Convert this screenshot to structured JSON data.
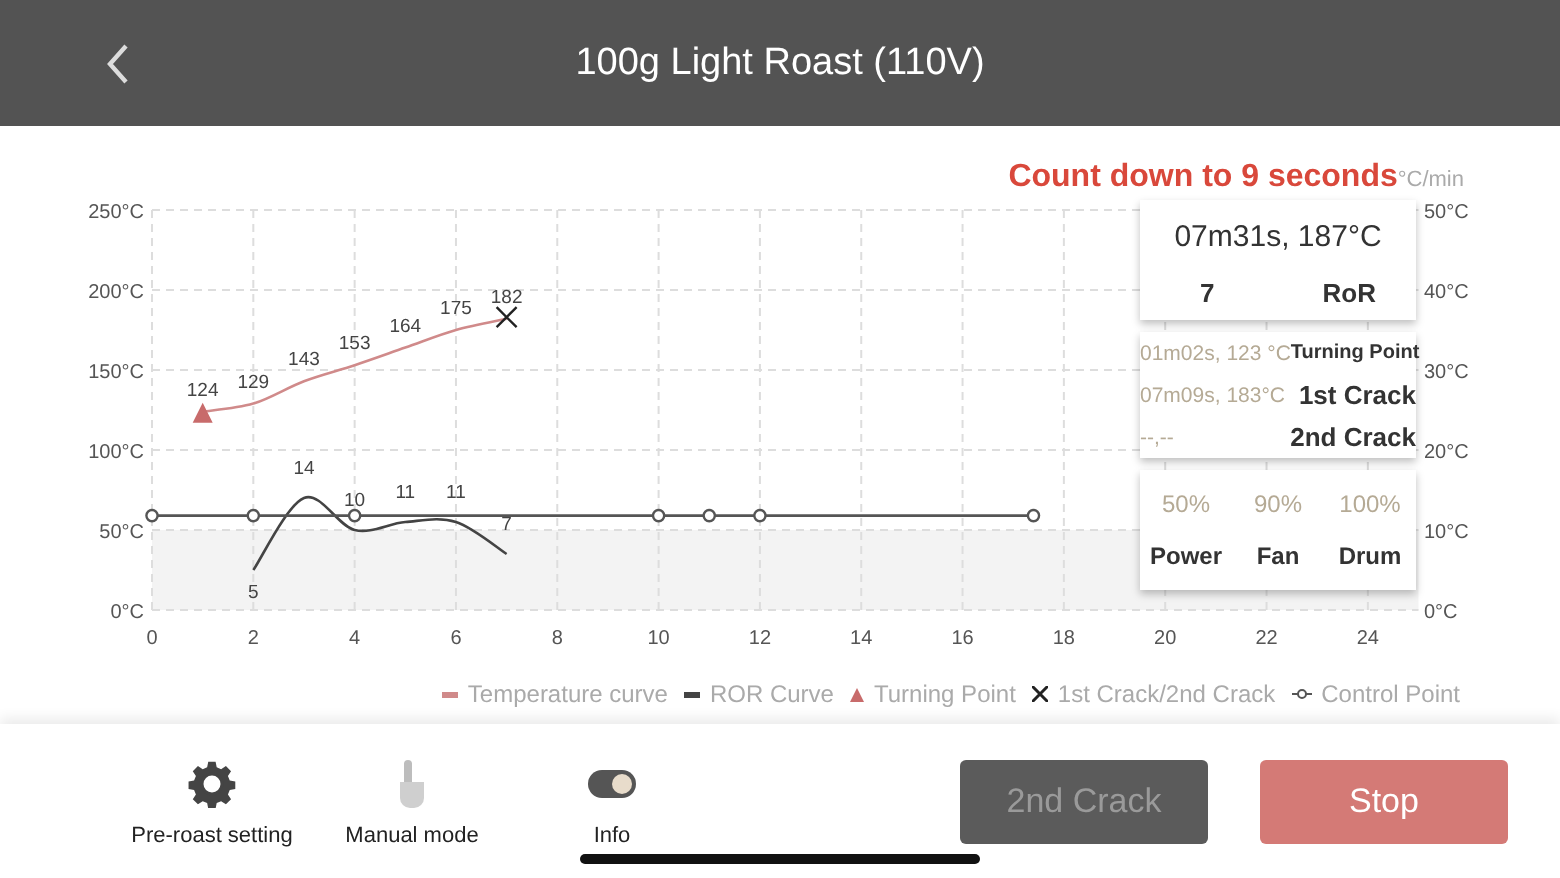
{
  "header": {
    "title": "100g Light Roast (110V)"
  },
  "countdown": "Count down to 9 seconds",
  "ror_unit": "°C/min",
  "chart_data": {
    "type": "line",
    "x": [
      0,
      1,
      2,
      3,
      4,
      5,
      6,
      7,
      10,
      11,
      12,
      17.4
    ],
    "series": [
      {
        "name": "Temperature curve",
        "color": "#d08a8a",
        "values": [
          null,
          124,
          129,
          143,
          153,
          164,
          175,
          182,
          null,
          null,
          null,
          null
        ],
        "value_labels": [
          null,
          "124",
          "129",
          "143",
          "153",
          "164",
          "175",
          "182",
          null,
          null,
          null,
          null
        ]
      },
      {
        "name": "ROR Curve",
        "color": "#444444",
        "axis": "y2",
        "values": [
          null,
          null,
          5,
          14,
          10,
          11,
          11,
          7,
          null,
          null,
          null,
          null
        ],
        "value_labels": [
          null,
          null,
          "5",
          "14",
          "10",
          "11",
          "11",
          "7",
          null,
          null,
          null,
          null
        ]
      },
      {
        "name": "Turning Point",
        "color": "#c86b6b",
        "marker": "triangle",
        "values": [
          null,
          122,
          null,
          null,
          null,
          null,
          null,
          null,
          null,
          null,
          null,
          null
        ]
      },
      {
        "name": "1st Crack/2nd Crack",
        "color": "#222222",
        "marker": "cross",
        "values": [
          null,
          null,
          null,
          null,
          null,
          null,
          null,
          183,
          null,
          null,
          null,
          null
        ]
      },
      {
        "name": "Control Point",
        "color": "#555555",
        "marker": "circle",
        "values": [
          59,
          null,
          59,
          null,
          59,
          null,
          null,
          null,
          59,
          59,
          59,
          59
        ]
      }
    ],
    "grid": true,
    "bands": [
      {
        "axis": "y",
        "from": 0,
        "to": 50
      }
    ],
    "xlim": [
      0,
      25
    ],
    "ylim": [
      0,
      250
    ],
    "y2lim": [
      0,
      50
    ],
    "xticks": [
      0,
      2,
      4,
      6,
      8,
      10,
      12,
      14,
      16,
      18,
      20,
      22,
      24
    ],
    "yticks": [
      {
        "value": 0,
        "label": "0°C"
      },
      {
        "value": 50,
        "label": "50°C"
      },
      {
        "value": 100,
        "label": "100°C"
      },
      {
        "value": 150,
        "label": "150°C"
      },
      {
        "value": 200,
        "label": "200°C"
      },
      {
        "value": 250,
        "label": "250°C"
      }
    ],
    "y2ticks": [
      {
        "value": 0,
        "label": "0°C"
      },
      {
        "value": 10,
        "label": "10°C"
      },
      {
        "value": 20,
        "label": "20°C"
      },
      {
        "value": 30,
        "label": "30°C"
      },
      {
        "value": 40,
        "label": "40°C"
      },
      {
        "value": 50,
        "label": "50°C"
      }
    ]
  },
  "info_panel": {
    "current": "07m31s, 187°C",
    "ror_value": "7",
    "ror_label": "RoR",
    "events": [
      {
        "value": "01m02s, 123 °C",
        "label": "Turning Point"
      },
      {
        "value": "07m09s, 183°C",
        "label": "1st Crack"
      },
      {
        "value": "--,--",
        "label": "2nd Crack"
      }
    ],
    "settings": [
      {
        "value": "50%",
        "label": "Power"
      },
      {
        "value": "90%",
        "label": "Fan"
      },
      {
        "value": "100%",
        "label": "Drum"
      }
    ]
  },
  "toolbar": [
    {
      "kind": "gear",
      "label": "Pre-roast setting",
      "disabled": false
    },
    {
      "kind": "hand",
      "label": "Manual mode",
      "disabled": true
    },
    {
      "kind": "toggle",
      "label": "Info",
      "on": true,
      "disabled": false
    }
  ],
  "actions": [
    {
      "kind": "crack",
      "label": "2nd Crack",
      "disabled": true
    },
    {
      "kind": "stop",
      "label": "Stop",
      "disabled": false
    }
  ]
}
